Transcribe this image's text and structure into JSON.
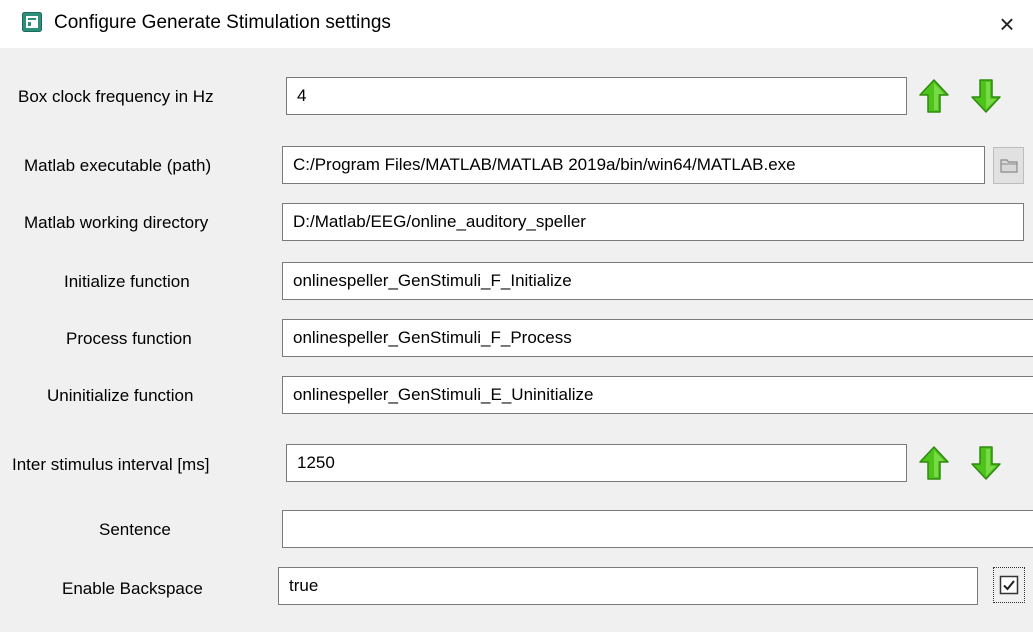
{
  "window": {
    "title": "Configure Generate Stimulation settings",
    "close_glyph": "×",
    "icon": "settings-window-icon"
  },
  "colors": {
    "arrow_green": "#4cc41a",
    "arrow_green_light": "#8fe25a",
    "arrow_outline": "#2f8a0f"
  },
  "fields": {
    "clock_freq": {
      "label": "Box clock frequency in Hz",
      "value": "4"
    },
    "matlab_exe": {
      "label": "Matlab executable (path)",
      "value": "C:/Program Files/MATLAB/MATLAB 2019a/bin/win64/MATLAB.exe"
    },
    "matlab_dir": {
      "label": "Matlab working directory",
      "value": "D:/Matlab/EEG/online_auditory_speller"
    },
    "init_fn": {
      "label": "Initialize function",
      "value": "onlinespeller_GenStimuli_F_Initialize"
    },
    "process_fn": {
      "label": "Process function",
      "value": "onlinespeller_GenStimuli_F_Process"
    },
    "uninit_fn": {
      "label": "Uninitialize function",
      "value": "onlinespeller_GenStimuli_E_Uninitialize"
    },
    "isi": {
      "label": "Inter stimulus interval [ms]",
      "value": "1250"
    },
    "sentence": {
      "label": "Sentence",
      "value": ""
    },
    "backspace": {
      "label": "Enable Backspace",
      "value": "true",
      "checked": true
    }
  },
  "icons": {
    "up": "arrow-up-icon",
    "down": "arrow-down-icon",
    "browse": "folder-icon",
    "check": "checkbox-icon"
  }
}
